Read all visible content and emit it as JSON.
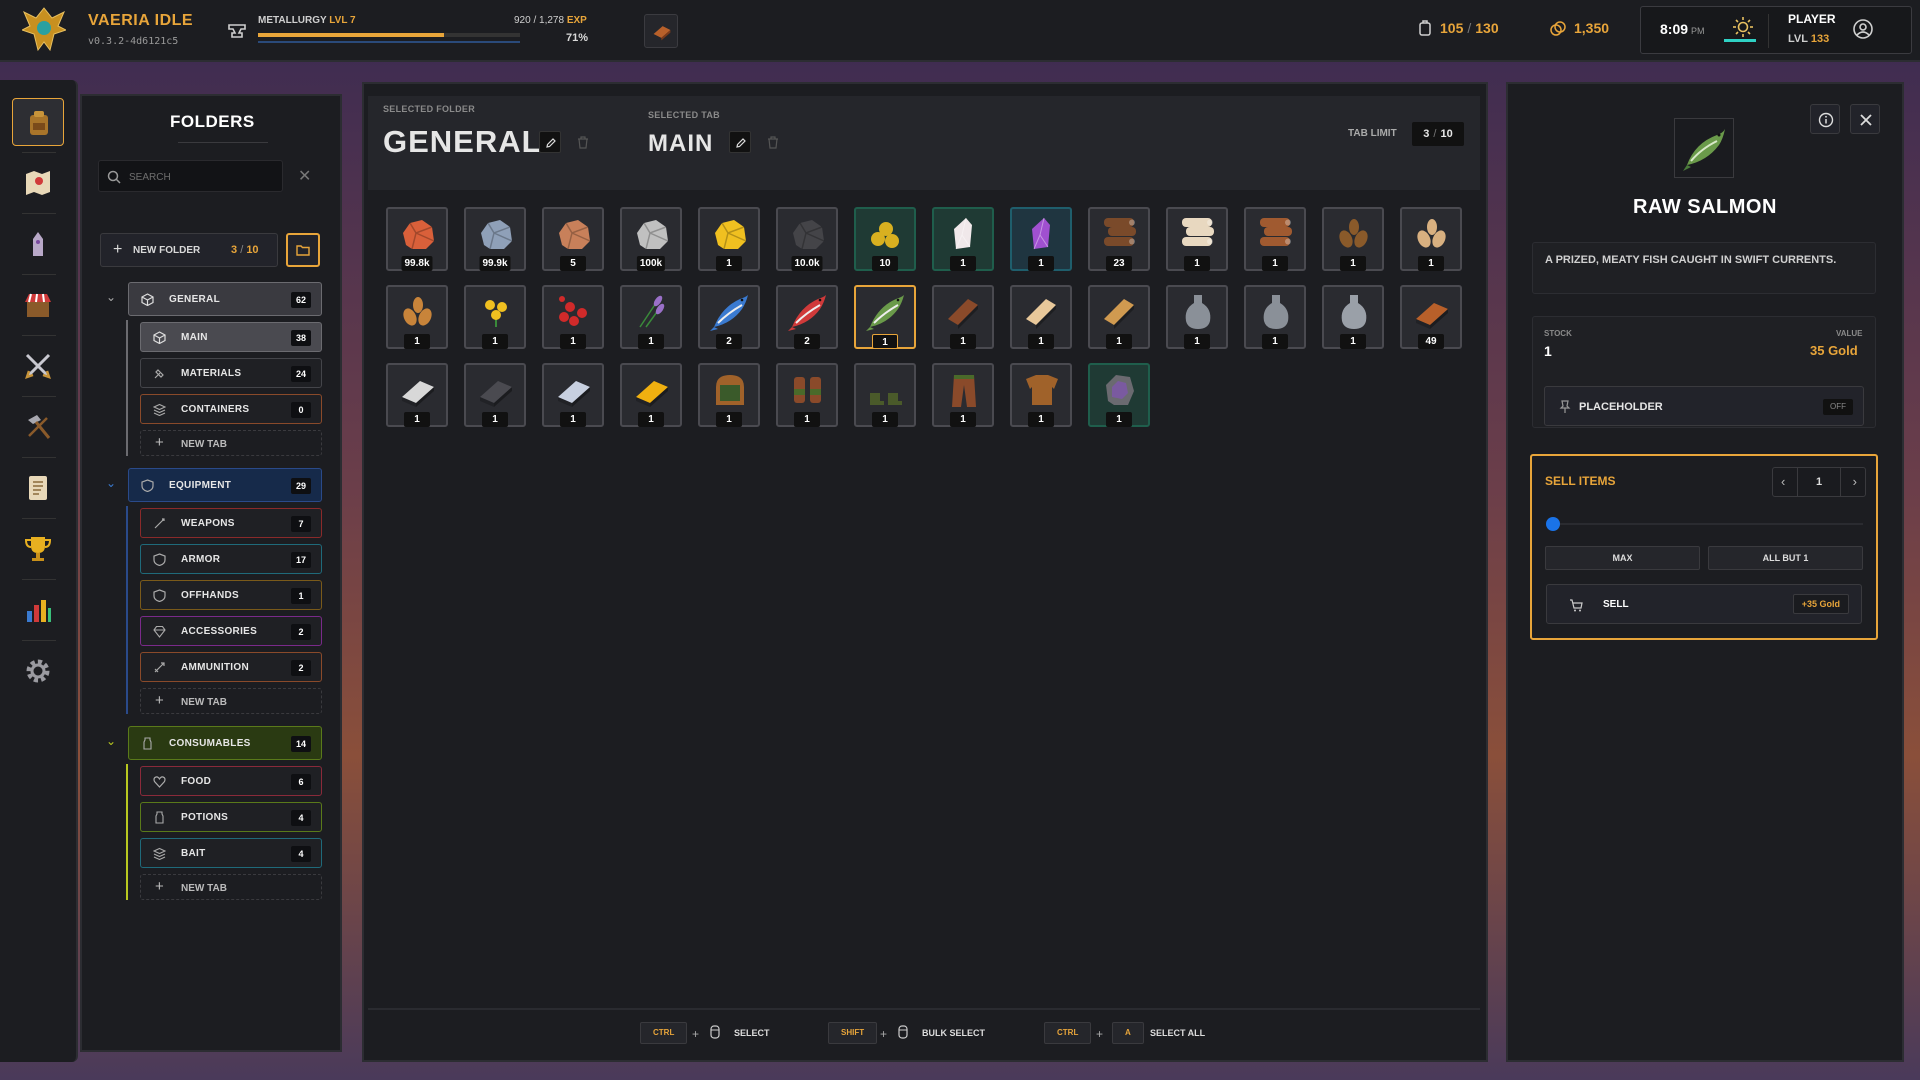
{
  "app": {
    "title": "VAERIA IDLE",
    "version": "v0.3.2-4d6121c5"
  },
  "skill": {
    "name": "METALLURGY",
    "level": "LVL 7",
    "exp_current": "920",
    "exp_max": "1,278",
    "exp_unit": "EXP",
    "percent_label": "71%",
    "progress": 0.71
  },
  "header": {
    "inventory_used": "105",
    "inventory_max": "130",
    "gold": "1,350",
    "time": "8:09",
    "ampm": "PM",
    "player_label": "PLAYER",
    "player_level_prefix": "LVL",
    "player_level": "133"
  },
  "nav": {
    "items": [
      "backpack-icon",
      "map-icon",
      "tower-icon",
      "shop-icon",
      "swords-icon",
      "hammer-icon",
      "scroll-icon",
      "trophy-icon",
      "stats-icon",
      "gear-icon"
    ],
    "active": 0
  },
  "folders": {
    "title": "FOLDERS",
    "search_placeholder": "SEARCH",
    "new_folder_label": "NEW FOLDER",
    "folder_count": "3",
    "folder_max": "10",
    "new_tab_label": "NEW TAB",
    "groups": [
      {
        "name": "GENERAL",
        "count": "62",
        "color": "#6b6b70",
        "tabs": [
          {
            "name": "MAIN",
            "count": "38",
            "color": "#6b6b70"
          },
          {
            "name": "MATERIALS",
            "count": "24",
            "color": "#44454a"
          },
          {
            "name": "CONTAINERS",
            "count": "0",
            "color": "#8a4a2a"
          }
        ]
      },
      {
        "name": "EQUIPMENT",
        "count": "29",
        "color": "#2a4a8a",
        "tabs": [
          {
            "name": "WEAPONS",
            "count": "7",
            "color": "#8a2a2a"
          },
          {
            "name": "ARMOR",
            "count": "17",
            "color": "#1f6a7a"
          },
          {
            "name": "OFFHANDS",
            "count": "1",
            "color": "#7a5a1a"
          },
          {
            "name": "ACCESSORIES",
            "count": "2",
            "color": "#7a2a8a"
          },
          {
            "name": "AMMUNITION",
            "count": "2",
            "color": "#8a4a2a"
          }
        ]
      },
      {
        "name": "CONSUMABLES",
        "count": "14",
        "color": "#5a7a1a",
        "tabs": [
          {
            "name": "FOOD",
            "count": "6",
            "color": "#8a2a3a"
          },
          {
            "name": "POTIONS",
            "count": "4",
            "color": "#5a7a1a"
          },
          {
            "name": "BAIT",
            "count": "4",
            "color": "#1f6a7a"
          }
        ]
      }
    ]
  },
  "main": {
    "selected_folder_caption": "SELECTED FOLDER",
    "selected_folder": "GENERAL",
    "selected_tab_caption": "SELECTED TAB",
    "selected_tab": "MAIN",
    "tab_limit_label": "TAB LIMIT",
    "tab_limit_used": "3",
    "tab_limit_max": "10",
    "items": [
      {
        "icon": "copper-ore-icon",
        "qty": "99.8k",
        "color": "#d9603a"
      },
      {
        "icon": "tin-ore-icon",
        "qty": "99.9k",
        "color": "#8fa0b8"
      },
      {
        "icon": "clay-ore-icon",
        "qty": "5",
        "color": "#c8805a"
      },
      {
        "icon": "silver-ore-icon",
        "qty": "100k",
        "color": "#c0c0c0"
      },
      {
        "icon": "gold-ore-icon",
        "qty": "1",
        "color": "#f0c020"
      },
      {
        "icon": "coal-icon",
        "qty": "10.0k",
        "color": "#444448"
      },
      {
        "icon": "gold-nuggets-icon",
        "qty": "10",
        "color": "#d8b020",
        "rarity": "green"
      },
      {
        "icon": "quartz-crystal-icon",
        "qty": "1",
        "color": "#f0e8ea",
        "rarity": "green"
      },
      {
        "icon": "amethyst-crystal-icon",
        "qty": "1",
        "color": "#a050d0",
        "rarity": "teal"
      },
      {
        "icon": "oak-log-icon",
        "qty": "23",
        "color": "#7a4a2a"
      },
      {
        "icon": "birch-log-icon",
        "qty": "1",
        "color": "#e8d8c0"
      },
      {
        "icon": "pine-log-icon",
        "qty": "1",
        "color": "#a05a30"
      },
      {
        "icon": "cocoa-seeds-icon",
        "qty": "1",
        "color": "#8a5a2a"
      },
      {
        "icon": "wheat-seeds-icon",
        "qty": "1",
        "color": "#d8b080"
      },
      {
        "icon": "almond-seeds-icon",
        "qty": "1",
        "color": "#c8843a"
      },
      {
        "icon": "yellow-flower-icon",
        "qty": "1",
        "color": "#f0c020"
      },
      {
        "icon": "berries-icon",
        "qty": "1",
        "color": "#d02a2a"
      },
      {
        "icon": "lavender-icon",
        "qty": "1",
        "color": "#9a70c8"
      },
      {
        "icon": "sardine-icon",
        "qty": "2",
        "color": "#3a7ad0"
      },
      {
        "icon": "red-snapper-icon",
        "qty": "2",
        "color": "#d03a3a"
      },
      {
        "icon": "raw-salmon-icon",
        "qty": "1",
        "color": "#6a9a4a",
        "selected": true
      },
      {
        "icon": "oak-plank-icon",
        "qty": "1",
        "color": "#8a4a2a"
      },
      {
        "icon": "birch-plank-icon",
        "qty": "1",
        "color": "#e8c89a"
      },
      {
        "icon": "pine-plank-icon",
        "qty": "1",
        "color": "#d09a50"
      },
      {
        "icon": "empty-vial-icon",
        "qty": "1",
        "color": "#8a9098"
      },
      {
        "icon": "small-bottle-icon",
        "qty": "1",
        "color": "#8a9098"
      },
      {
        "icon": "tall-bottle-icon",
        "qty": "1",
        "color": "#9aa0a8"
      },
      {
        "icon": "copper-bar-icon",
        "qty": "49",
        "color": "#b8602a"
      },
      {
        "icon": "silver-bar-icon",
        "qty": "1",
        "color": "#d8d8d8"
      },
      {
        "icon": "iron-bar-icon",
        "qty": "1",
        "color": "#4a4a50"
      },
      {
        "icon": "tin-bar-icon",
        "qty": "1",
        "color": "#c8d0e0"
      },
      {
        "icon": "gold-bar-icon",
        "qty": "1",
        "color": "#f0b010"
      },
      {
        "icon": "leather-hood-icon",
        "qty": "1",
        "color": "#a0622a"
      },
      {
        "icon": "leather-gloves-icon",
        "qty": "1",
        "color": "#8a4a2a"
      },
      {
        "icon": "leather-boots-icon",
        "qty": "1",
        "color": "#4a5a2a"
      },
      {
        "icon": "leather-pants-icon",
        "qty": "1",
        "color": "#8a4a2a"
      },
      {
        "icon": "leather-chest-icon",
        "qty": "1",
        "color": "#a0622a"
      },
      {
        "icon": "geode-icon",
        "qty": "1",
        "color": "#7a5aa0",
        "rarity": "green"
      }
    ],
    "shortcuts": [
      {
        "keys": [
          "CTRL"
        ],
        "mouse": true,
        "label": "SELECT"
      },
      {
        "keys": [
          "SHIFT"
        ],
        "mouse": true,
        "label": "BULK SELECT"
      },
      {
        "keys": [
          "CTRL",
          "A"
        ],
        "mouse": false,
        "label": "SELECT ALL"
      }
    ]
  },
  "detail": {
    "name": "RAW SALMON",
    "description": "A PRIZED, MEATY FISH CAUGHT IN SWIFT CURRENTS.",
    "stock_label": "STOCK",
    "stock": "1",
    "value_label": "VALUE",
    "value": "35 Gold",
    "placeholder_label": "PLACEHOLDER",
    "placeholder_state": "OFF",
    "sell_title": "SELL ITEMS",
    "sell_qty": "1",
    "sell_slider": 0,
    "max_label": "MAX",
    "all_but_one_label": "ALL BUT 1",
    "sell_label": "SELL",
    "sell_gain": "+35 Gold"
  },
  "colors": {
    "accent": "#e8a53a",
    "panel": "#1c1d21",
    "slider": "#1a73e8"
  }
}
